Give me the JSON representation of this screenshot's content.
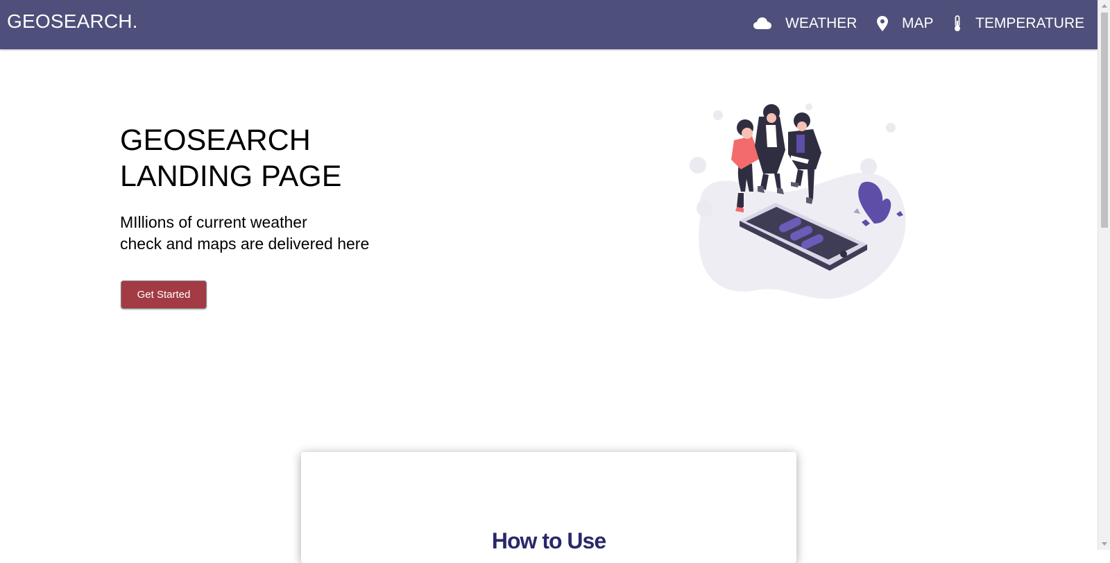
{
  "nav": {
    "brand": "GEOSEARCH.",
    "items": [
      {
        "label": "WEATHER",
        "icon": "cloud-icon"
      },
      {
        "label": "MAP",
        "icon": "map-pin-icon"
      },
      {
        "label": "TEMPERATURE",
        "icon": "thermometer-icon"
      }
    ]
  },
  "hero": {
    "title_line1": "GEOSEARCH",
    "title_line2": "LANDING PAGE",
    "subtitle_line1": "MIllions of current weather",
    "subtitle_line2": "check and maps are delivered here",
    "cta_label": "Get Started"
  },
  "how_to_use": {
    "title": "How to Use"
  },
  "colors": {
    "navbar": "#4f4f7b",
    "cta": "#a23b43",
    "accent_purple": "#5e4ea8",
    "heading_dark_blue": "#28286a"
  }
}
